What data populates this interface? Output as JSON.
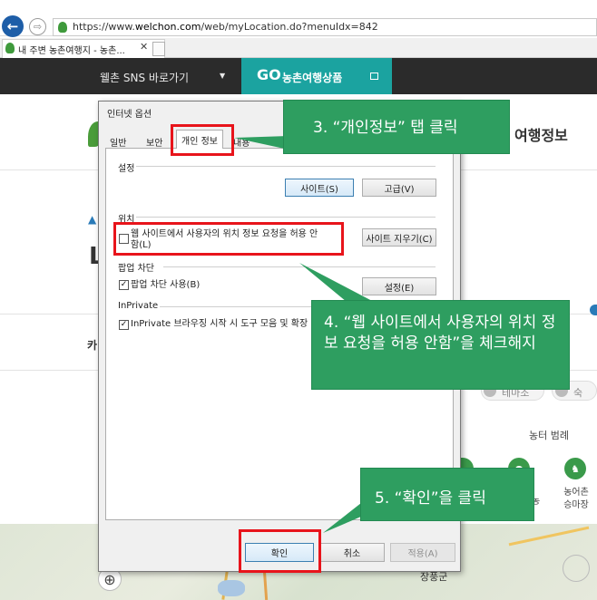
{
  "browser": {
    "url_prefix": "https://www.",
    "url_domain": "welchon.com",
    "url_path": "/web/myLocation.do?menuIdx=842",
    "back_icon": "back-arrow-icon",
    "forward_icon": "forward-arrow-icon",
    "tab_title": "내 주변 농촌여행지 - 농촌...",
    "tab_close": "✕"
  },
  "site": {
    "sns_label": "웰촌 SNS 바로가기",
    "sns_caret": "▼",
    "go_label": "GO",
    "go_sub": "농촌여행상품",
    "page_heading": "여행정보",
    "big_letter": "L",
    "side_label": "카",
    "chip_1": "테마조",
    "chip_2": "숙",
    "legend_title": "농터 범례",
    "legend_item_1": "농",
    "legend_item_2": "농어촌\n승마장",
    "map_town": "장풍군",
    "brand_green": "#1ba3a0"
  },
  "dialog": {
    "title": "인터넷 옵션",
    "tabs": [
      "일반",
      "보안",
      "개인 정보",
      "내용",
      "연"
    ],
    "active_tab": "개인 정보",
    "settings": {
      "label": "설정",
      "sites_button": "사이트(S)",
      "advanced_button": "고급(V)"
    },
    "location": {
      "label": "위치",
      "checkbox_label": "웹 사이트에서 사용자의 위치 정보 요청을 허용 안 함(L)",
      "checked": false,
      "clear_button": "사이트 지우기(C)"
    },
    "popup": {
      "label": "팝업 차단",
      "checkbox_label": "팝업 차단 사용(B)",
      "checked": true,
      "settings_button": "설정(E)"
    },
    "inprivate": {
      "label": "InPrivate",
      "checkbox_label": "InPrivate 브라우징 시작 시 도구 모음 및 확장",
      "checked": true
    },
    "ok_button": "확인",
    "cancel_button": "취소",
    "apply_button": "적용(A)"
  },
  "annotations": {
    "step3": "3. “개인정보” 탭 클릭",
    "step4": "4. “웹 사이트에서 사용자의 위치 정보 요청을 허용 안함”을 체크해지",
    "step5": "5. “확인”을 클릭",
    "highlight_color": "#e8141b",
    "callout_color": "#2e9e60"
  }
}
